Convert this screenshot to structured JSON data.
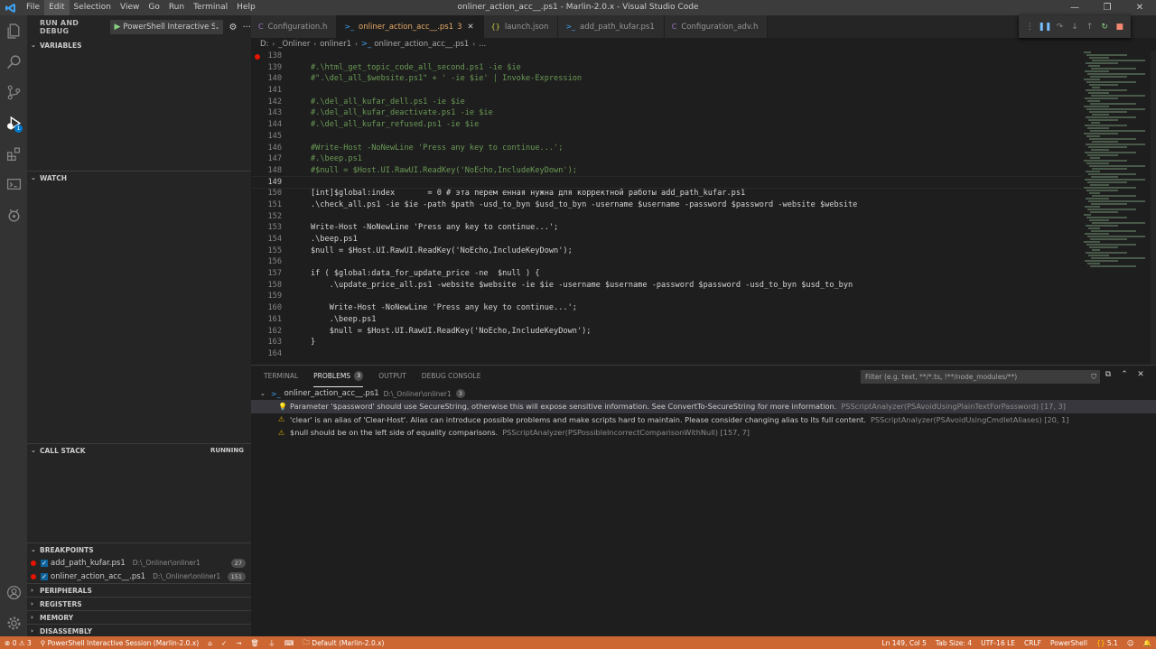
{
  "window": {
    "title": "onliner_action_acc__.ps1 - Marlin-2.0.x - Visual Studio Code"
  },
  "menu": [
    "File",
    "Edit",
    "Selection",
    "View",
    "Go",
    "Run",
    "Terminal",
    "Help"
  ],
  "activity": {
    "debug_badge": "1"
  },
  "sidebar": {
    "title": "RUN AND DEBUG",
    "config": "PowerShell Interactive Se",
    "sections": {
      "variables": "VARIABLES",
      "watch": "WATCH",
      "call_stack": "CALL STACK",
      "call_stack_status": "RUNNING",
      "breakpoints": "BREAKPOINTS",
      "peripherals": "PERIPHERALS",
      "registers": "REGISTERS",
      "memory": "MEMORY",
      "disassembly": "DISASSEMBLY"
    },
    "breakpoints": [
      {
        "file": "add_path_kufar.ps1",
        "path": "D:\\_Onliner\\onliner1",
        "line": "27"
      },
      {
        "file": "onliner_action_acc__.ps1",
        "path": "D:\\_Onliner\\onliner1",
        "line": "151"
      }
    ]
  },
  "tabs": [
    {
      "label": "Configuration.h",
      "icon": "C"
    },
    {
      "label": "onliner_action_acc__.ps1",
      "icon": ">_",
      "problems": "3",
      "active": true
    },
    {
      "label": "launch.json",
      "icon": "{}"
    },
    {
      "label": "add_path_kufar.ps1",
      "icon": ">_"
    },
    {
      "label": "Configuration_adv.h",
      "icon": "C"
    }
  ],
  "breadcrumb": [
    "D:",
    "_Onliner",
    "onliner1",
    "onliner_action_acc__.ps1",
    "..."
  ],
  "editor": {
    "lines": [
      {
        "n": "138",
        "t": ""
      },
      {
        "n": "139",
        "t": "#.\\html_get_topic_code_all_second.ps1 -ie $ie",
        "cls": "cm"
      },
      {
        "n": "140",
        "t": "#\".\\del_all_$website.ps1\" + ' -ie $ie' | Invoke-Expression",
        "cls": "cm"
      },
      {
        "n": "141",
        "t": ""
      },
      {
        "n": "142",
        "t": "#.\\del_all_kufar_dell.ps1 -ie $ie",
        "cls": "cm"
      },
      {
        "n": "143",
        "t": "#.\\del_all_kufar_deactivate.ps1 -ie $ie",
        "cls": "cm"
      },
      {
        "n": "144",
        "t": "#.\\del_all_kufar_refused.ps1 -ie $ie",
        "cls": "cm"
      },
      {
        "n": "145",
        "t": ""
      },
      {
        "n": "146",
        "t": "#Write-Host -NoNewLine 'Press any key to continue...';",
        "cls": "cm"
      },
      {
        "n": "147",
        "t": "#.\\beep.ps1",
        "cls": "cm"
      },
      {
        "n": "148",
        "t": "#$null = $Host.UI.RawUI.ReadKey('NoEcho,IncludeKeyDown');",
        "cls": "cm"
      },
      {
        "n": "149",
        "t": "",
        "current": true
      },
      {
        "n": "150",
        "t": "[int]$global:index       = 0 # эта перем енная нужна для корректной работы add_path_kufar.ps1"
      },
      {
        "n": "151",
        "t": ".\\check_all.ps1 -ie $ie -path $path -usd_to_byn $usd_to_byn -username $username -password $password -website $website",
        "bp": true
      },
      {
        "n": "152",
        "t": ""
      },
      {
        "n": "153",
        "t": "Write-Host -NoNewLine 'Press any key to continue...';"
      },
      {
        "n": "154",
        "t": ".\\beep.ps1"
      },
      {
        "n": "155",
        "t": "$null = $Host.UI.RawUI.ReadKey('NoEcho,IncludeKeyDown');"
      },
      {
        "n": "156",
        "t": ""
      },
      {
        "n": "157",
        "t": "if ( $global:data_for_update_price -ne  $null ) {"
      },
      {
        "n": "158",
        "t": "    .\\update_price_all.ps1 -website $website -ie $ie -username $username -password $password -usd_to_byn $usd_to_byn"
      },
      {
        "n": "159",
        "t": ""
      },
      {
        "n": "160",
        "t": "    Write-Host -NoNewLine 'Press any key to continue...';"
      },
      {
        "n": "161",
        "t": "    .\\beep.ps1"
      },
      {
        "n": "162",
        "t": "    $null = $Host.UI.RawUI.ReadKey('NoEcho,IncludeKeyDown');"
      },
      {
        "n": "163",
        "t": "}"
      },
      {
        "n": "164",
        "t": ""
      }
    ]
  },
  "panel": {
    "tabs": [
      {
        "label": "TERMINAL"
      },
      {
        "label": "PROBLEMS",
        "count": "3",
        "active": true
      },
      {
        "label": "OUTPUT"
      },
      {
        "label": "DEBUG CONSOLE"
      }
    ],
    "filter_placeholder": "Filter (e.g. text, **/*.ts, !**/node_modules/**)",
    "file": {
      "name": "onliner_action_acc__.ps1",
      "path": "D:\\_Onliner\\onliner1",
      "count": "3"
    },
    "problems": [
      {
        "icon": "lightbulb",
        "msg": "Parameter '$password' should use SecureString, otherwise this will expose sensitive information. See ConvertTo-SecureString for more information.",
        "src": "PSScriptAnalyzer(PSAvoidUsingPlainTextForPassword)  [17, 3]"
      },
      {
        "icon": "warning",
        "msg": "'clear' is an alias of 'Clear-Host'. Alias can introduce possible problems and make scripts hard to maintain. Please consider changing alias to its full content.",
        "src": "PSScriptAnalyzer(PSAvoidUsingCmdletAliases)  [20, 1]"
      },
      {
        "icon": "warning",
        "msg": "$null should be on the left side of equality comparisons.",
        "src": "PSScriptAnalyzer(PSPossibleIncorrectComparisonWithNull)  [157, 7]"
      }
    ]
  },
  "status": {
    "errors": "0",
    "warnings": "3",
    "session": "PowerShell Interactive Session (Marlin-2.0.x)",
    "config": "Default (Marlin-2.0.x)",
    "position": "Ln 149, Col 5",
    "tab_size": "Tab Size: 4",
    "encoding": "UTF-16 LE",
    "eol": "CRLF",
    "language": "PowerShell",
    "version": "5.1"
  },
  "colors": {
    "status_bar": "#cc6633",
    "accent": "#007acc",
    "breakpoint": "#e51400"
  }
}
